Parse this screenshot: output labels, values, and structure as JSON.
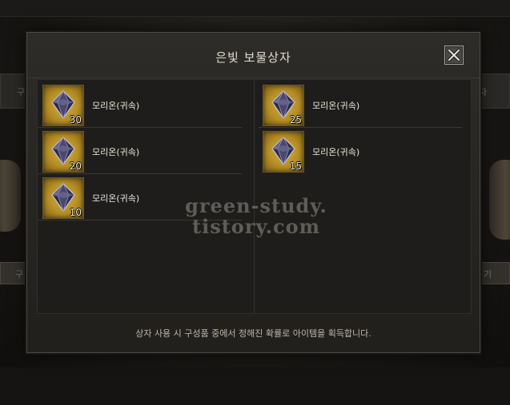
{
  "dialog": {
    "title": "은빛 보물상자",
    "notice": "상자 사용 시 구성품 중에서 정해진 확률로 아이템을 획득합니다.",
    "items": [
      {
        "name": "모리온(귀속)",
        "qty": "30"
      },
      {
        "name": "모리온(귀속)",
        "qty": "25"
      },
      {
        "name": "모리온(귀속)",
        "qty": "20"
      },
      {
        "name": "모리온(귀속)",
        "qty": "15"
      },
      {
        "name": "모리온(귀속)",
        "qty": "10"
      }
    ]
  },
  "background": {
    "left_header": "구",
    "right_header": "자",
    "left_strip": "구",
    "right_strip": "기"
  },
  "watermark": {
    "line1": "green-study.",
    "line2": "tistory.com"
  },
  "colors": {
    "slot_gold": "#d6b13f",
    "panel": "#272521",
    "text": "#ece7dc"
  },
  "icons": {
    "item": "morion-crystal-icon",
    "close": "close-icon"
  }
}
